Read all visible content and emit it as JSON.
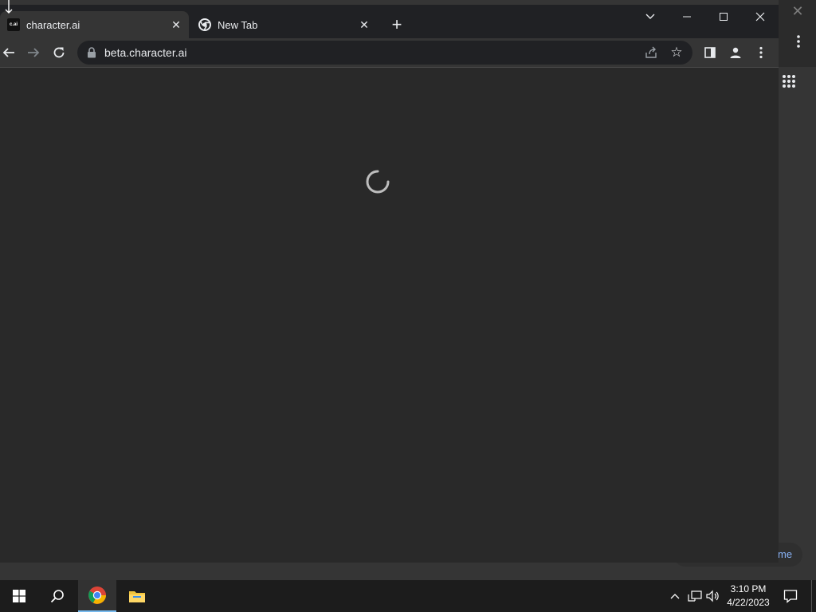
{
  "browser": {
    "tabs": [
      {
        "title": "character.ai",
        "favicon": "c.ai",
        "active": true
      },
      {
        "title": "New Tab",
        "favicon": "chrome-icon",
        "active": false
      }
    ],
    "url": "beta.character.ai"
  },
  "background_window": {
    "chip_text": "me"
  },
  "taskbar": {
    "time": "3:10 PM",
    "date": "4/22/2023"
  },
  "colors": {
    "tabstrip": "#202124",
    "toolbar": "#353535",
    "content": "#292929",
    "taskbar": "#1c1c1c",
    "accent": "#76b9ed"
  }
}
